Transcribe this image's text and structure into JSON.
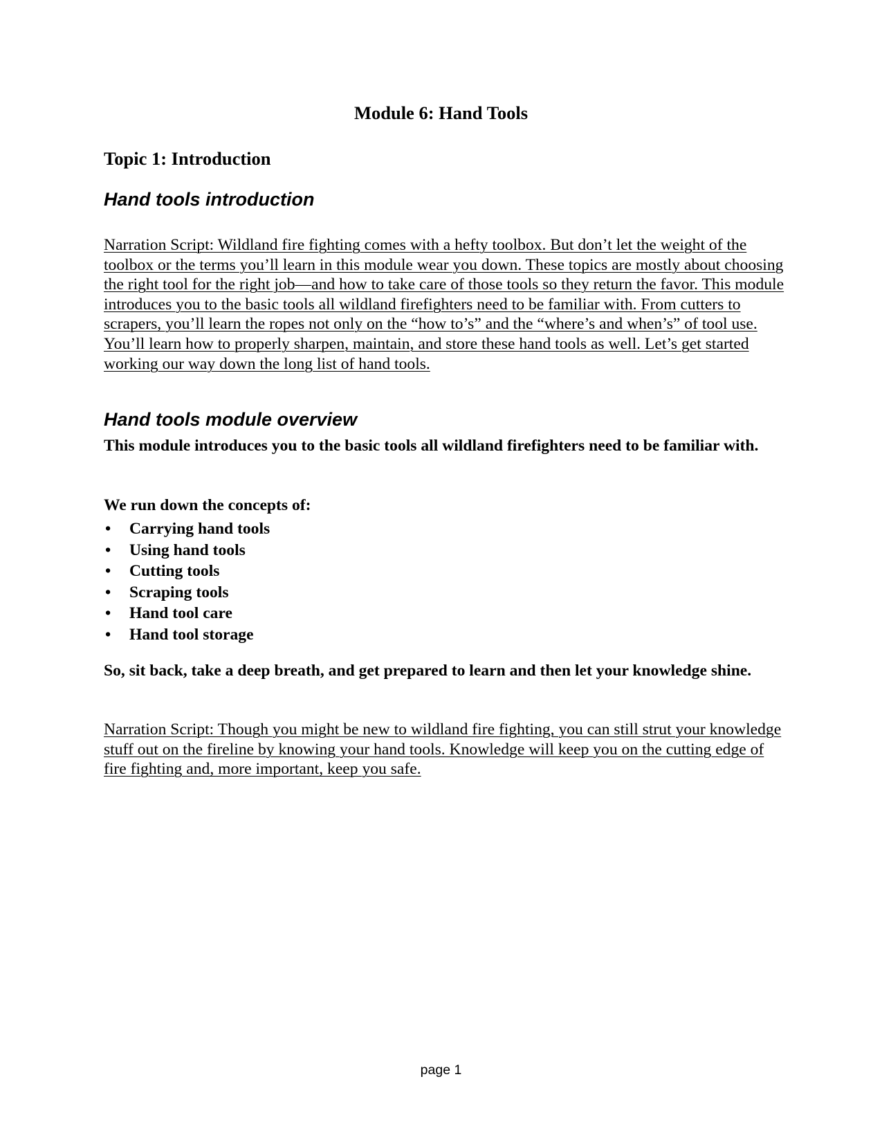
{
  "document": {
    "module_title": "Module 6:  Hand Tools",
    "topic_title": "Topic 1: Introduction",
    "sections": [
      {
        "heading": "Hand tools introduction",
        "narration": "Narration Script: Wildland fire fighting comes with a hefty toolbox. But don’t let the weight of the toolbox or the terms you’ll learn in this module wear you down. These topics are mostly about choosing the right tool for the right job—and how to take care of those tools so they return the favor. This module introduces you to the basic tools all wildland firefighters need to be familiar with. From cutters to scrapers, you’ll learn the ropes not only on the “how to’s” and the “where’s and when’s” of tool use. You’ll learn how to properly sharpen, maintain, and store these hand tools as well. Let’s get started working our way down the long list of hand tools."
      },
      {
        "heading": "Hand tools module overview",
        "intro": "This module introduces you to the basic tools all wildland firefighters need to be familiar with.",
        "list_intro": "We run down the concepts of:",
        "concepts": [
          "Carrying hand tools",
          "Using hand tools",
          "Cutting tools",
          "Scraping tools",
          "Hand tool care",
          "Hand tool storage"
        ],
        "closing": "So, sit back, take a deep breath, and get prepared to learn and then let your knowledge shine.",
        "narration": "Narration Script: Though you might be new to wildland fire fighting, you can still strut your knowledge stuff out on the fireline by knowing your hand tools. Knowledge will keep you on the cutting edge of fire fighting and, more important, keep you safe."
      }
    ],
    "bullet_glyph": "•",
    "footer": "page 1"
  }
}
